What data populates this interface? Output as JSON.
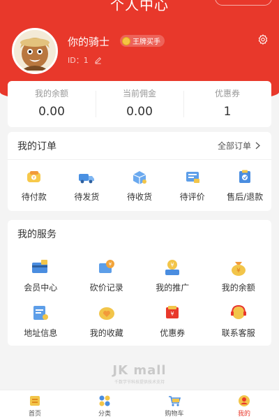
{
  "header": {
    "title": "个人中心",
    "nickname": "你的骑士",
    "badge": "王牌买手",
    "uid_label": "ID：1",
    "accent": "#e8382b"
  },
  "stats": [
    {
      "label": "我的余额",
      "value": "0.00"
    },
    {
      "label": "当前佣金",
      "value": "0.00"
    },
    {
      "label": "优惠券",
      "value": "1"
    }
  ],
  "orders": {
    "title": "我的订单",
    "more_label": "全部订单",
    "items": [
      {
        "label": "待付款",
        "icon": "wallet-icon"
      },
      {
        "label": "待发货",
        "icon": "truck-icon"
      },
      {
        "label": "待收货",
        "icon": "package-icon"
      },
      {
        "label": "待评价",
        "icon": "review-icon"
      },
      {
        "label": "售后/退款",
        "icon": "refund-icon"
      }
    ]
  },
  "services": {
    "title": "我的服务",
    "items": [
      {
        "label": "会员中心",
        "icon": "member-card-icon"
      },
      {
        "label": "砍价记录",
        "icon": "bargain-icon"
      },
      {
        "label": "我的推广",
        "icon": "promotion-icon"
      },
      {
        "label": "我的余额",
        "icon": "money-bag-icon"
      },
      {
        "label": "地址信息",
        "icon": "address-icon"
      },
      {
        "label": "我的收藏",
        "icon": "favorite-icon"
      },
      {
        "label": "优惠券",
        "icon": "coupon-icon"
      },
      {
        "label": "联系客服",
        "icon": "service-icon"
      }
    ]
  },
  "footer": {
    "brand": "JK mall",
    "tagline": "千数学节科技提供技术支持"
  },
  "tabbar": [
    {
      "label": "首页",
      "icon": "home-icon"
    },
    {
      "label": "分类",
      "icon": "category-icon"
    },
    {
      "label": "购物车",
      "icon": "cart-icon"
    },
    {
      "label": "我的",
      "icon": "profile-icon"
    }
  ]
}
